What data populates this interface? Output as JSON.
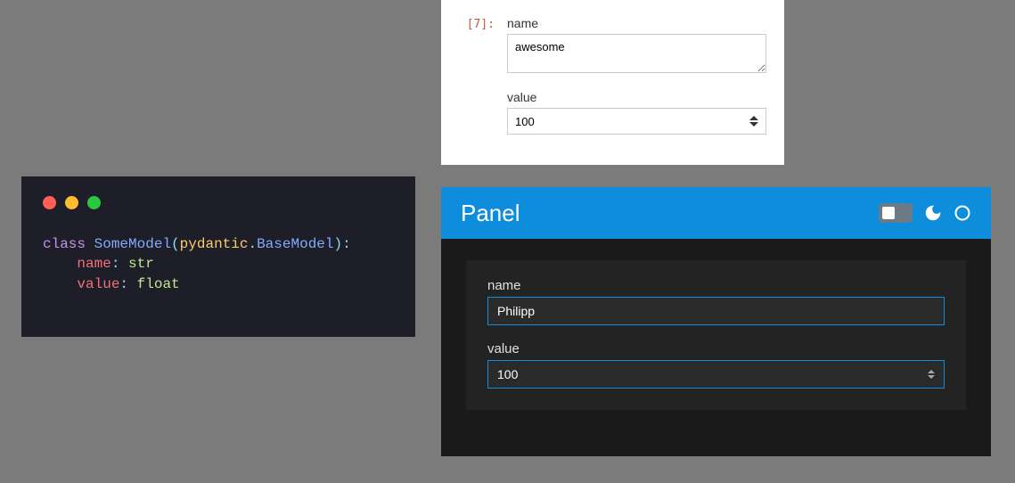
{
  "code_editor": {
    "keyword_class": "class",
    "classname": "SomeModel",
    "module": "pydantic",
    "baseclass": "BaseModel",
    "field1_name": "name",
    "field1_type": "str",
    "field2_name": "value",
    "field2_type": "float"
  },
  "jupyter": {
    "prompt": "[7]:",
    "name_label": "name",
    "name_value": "awesome",
    "value_label": "value",
    "value_value": "100"
  },
  "panel": {
    "title": "Panel",
    "name_label": "name",
    "name_value": "Philipp",
    "value_label": "value",
    "value_value": "100"
  }
}
